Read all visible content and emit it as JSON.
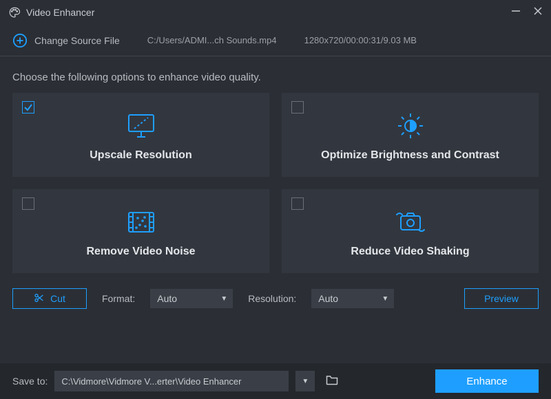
{
  "titlebar": {
    "title": "Video Enhancer"
  },
  "source": {
    "change_label": "Change Source File",
    "path": "C:/Users/ADMI...ch Sounds.mp4",
    "meta": "1280x720/00:00:31/9.03 MB"
  },
  "instruction": "Choose the following options to enhance video quality.",
  "options": {
    "upscale": {
      "label": "Upscale Resolution",
      "checked": true
    },
    "brightness": {
      "label": "Optimize Brightness and Contrast",
      "checked": false
    },
    "noise": {
      "label": "Remove Video Noise",
      "checked": false
    },
    "shaking": {
      "label": "Reduce Video Shaking",
      "checked": false
    }
  },
  "controls": {
    "cut_label": "Cut",
    "format_label": "Format:",
    "format_value": "Auto",
    "resolution_label": "Resolution:",
    "resolution_value": "Auto",
    "preview_label": "Preview"
  },
  "bottom": {
    "save_label": "Save to:",
    "save_path": "C:\\Vidmore\\Vidmore V...erter\\Video Enhancer",
    "enhance_label": "Enhance"
  }
}
